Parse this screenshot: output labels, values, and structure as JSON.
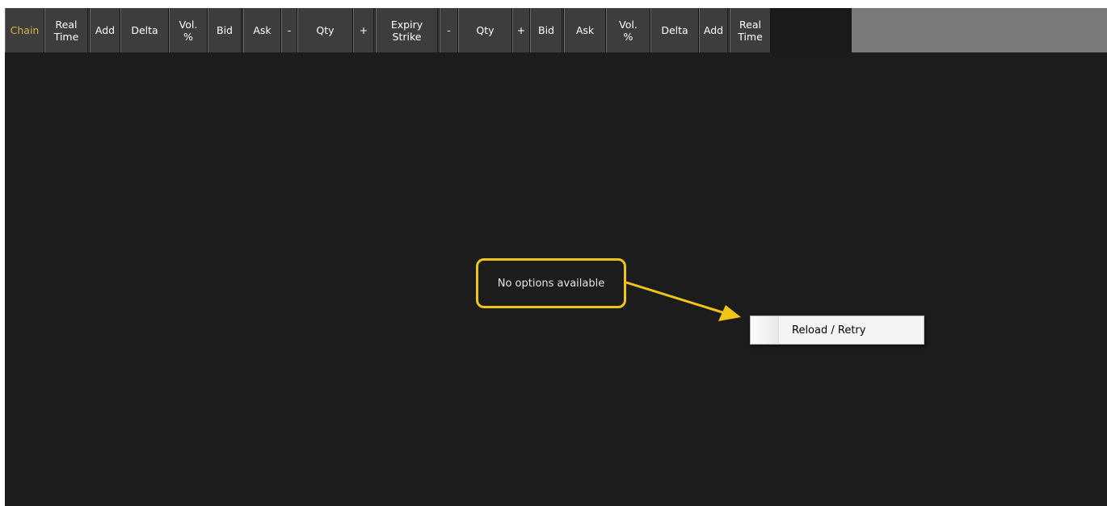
{
  "header": {
    "columns": [
      {
        "label": "Chain",
        "active": true
      },
      {
        "label": "Real\nTime"
      },
      {
        "label": "Add"
      },
      {
        "label": "Delta"
      },
      {
        "label": "Vol.\n%"
      },
      {
        "label": "Bid"
      },
      {
        "label": "Ask"
      },
      {
        "label": "-"
      },
      {
        "label": "Qty"
      },
      {
        "label": "+"
      },
      {
        "label": "Expiry\nStrike"
      },
      {
        "label": "-"
      },
      {
        "label": "Qty"
      },
      {
        "label": "+"
      },
      {
        "label": "Bid"
      },
      {
        "label": "Ask"
      },
      {
        "label": "Vol.\n%"
      },
      {
        "label": "Delta"
      },
      {
        "label": "Add"
      },
      {
        "label": "Real\nTime"
      }
    ]
  },
  "body": {
    "empty_message": "No options available"
  },
  "context_menu": {
    "items": [
      {
        "label": "Reload / Retry"
      }
    ]
  },
  "colors": {
    "background": "#1c1c1c",
    "header_bg": "#3d3d3d",
    "active_text": "#d9b240",
    "callout": "#f0c419"
  }
}
